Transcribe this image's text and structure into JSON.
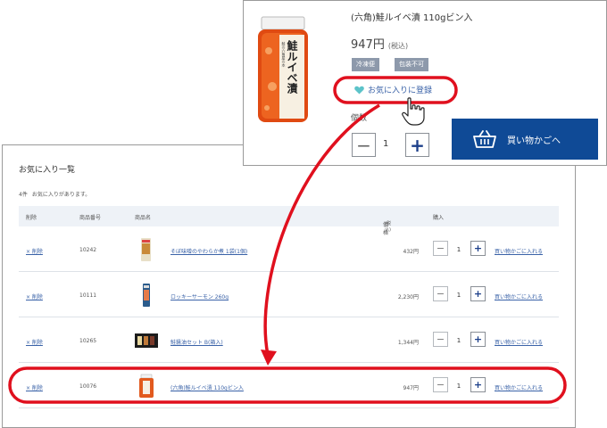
{
  "detail": {
    "product_title": "(六角)鮭ルイベ漬 110gビン入",
    "price": "947円",
    "tax_note": "(税込)",
    "badges": [
      "冷凍便",
      "包装不可"
    ],
    "favorite_label": "お気に入りに登録",
    "quantity_label": "個数",
    "quantity": "1",
    "minus_symbol": "−",
    "plus_symbol": "+",
    "cart_button_label": "買い物かごへ",
    "jar_label": "鮭ルイベ漬",
    "jar_small_label": "鮭の六角屋の本"
  },
  "favorites": {
    "title": "お気に入り一覧",
    "count": "4件",
    "count_suffix": "お気に入りがあります。",
    "headers": {
      "delete": "削除",
      "code": "商品番号",
      "name": "商品名",
      "price": "価格",
      "price_note": "(税込)",
      "buy": "購入"
    },
    "rows": [
      {
        "delete": "× 削除",
        "code": "10242",
        "name": "そぼ味噌のやわらか煮 1袋(1個)",
        "price": "432円",
        "qty": "1",
        "cart": "買い物かごに入れる"
      },
      {
        "delete": "× 削除",
        "code": "10111",
        "name": "ロッキーサーモン 260g",
        "price": "2,230円",
        "qty": "1",
        "cart": "買い物かごに入れる"
      },
      {
        "delete": "× 削除",
        "code": "10265",
        "name": "鮭醤油セット B(箱入)",
        "price": "1,344円",
        "qty": "1",
        "cart": "買い物かごに入れる"
      },
      {
        "delete": "× 削除",
        "code": "10076",
        "name": "(六角)鮭ルイベ漬 110gビン入",
        "price": "947円",
        "qty": "1",
        "cart": "買い物かごに入れる"
      }
    ]
  },
  "colors": {
    "accent_blue": "#0f4a96",
    "link_blue": "#3b63a8",
    "badge_gray": "#8d99ab",
    "annotation_red": "#e0101e",
    "heart_teal": "#5cc3c9"
  },
  "icons": {
    "favorite": "heart-icon",
    "cart": "shopping-basket-icon",
    "pointer": "hand-pointer-icon"
  }
}
